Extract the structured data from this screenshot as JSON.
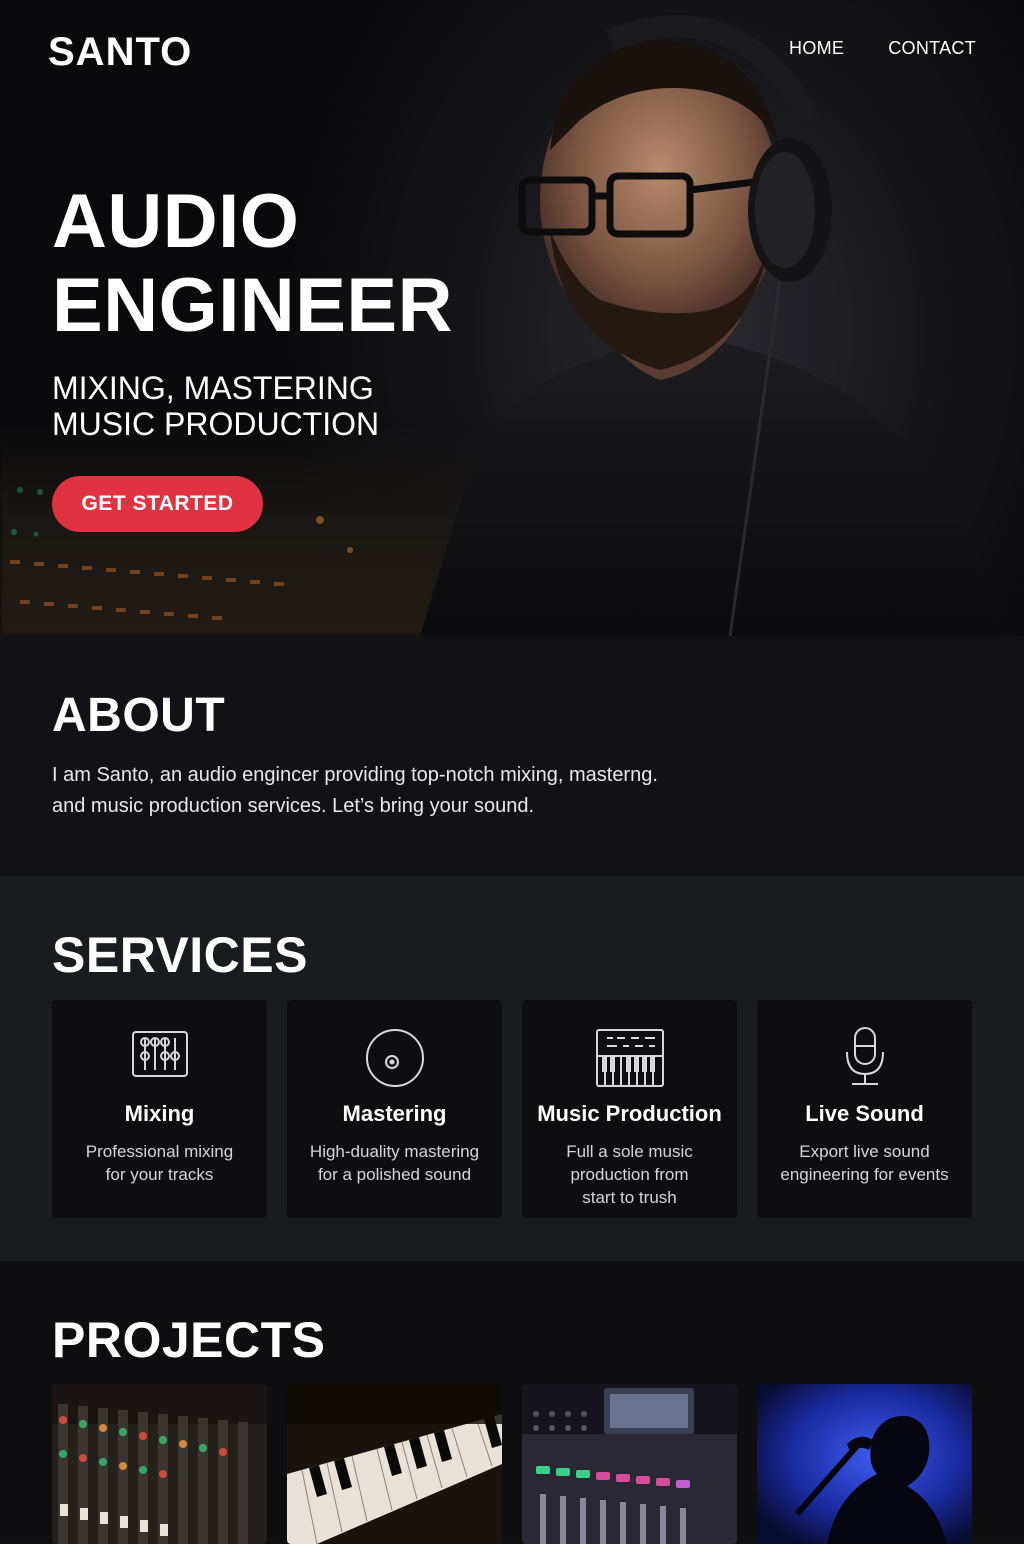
{
  "header": {
    "brand": "SANTO",
    "nav": [
      "HOME",
      "CONTACT"
    ]
  },
  "hero": {
    "title_line1": "AUDIO",
    "title_line2": "ENGINEER",
    "subtitle_line1": "MIXING, MASTERING",
    "subtitle_line2": "MUSIC PRODUCTION",
    "cta_label": "GET STARTED"
  },
  "about": {
    "heading": "ABOUT",
    "text_line1": "I am Santo, an audio engincer providing top-notch mixing, masterng.",
    "text_line2": "and music production services. Let’s bring your sound."
  },
  "services": {
    "heading": "SERVICES",
    "items": [
      {
        "title": "Mixing",
        "desc_lines": [
          "Professional mixing",
          "for your tracks"
        ],
        "icon": "mixer-faders-icon"
      },
      {
        "title": "Mastering",
        "desc_lines": [
          "High-duality mastering",
          "for a polished sound"
        ],
        "icon": "vinyl-disc-icon"
      },
      {
        "title": "Music Production",
        "desc_lines": [
          "Full a sole music",
          "production from",
          "start to trush"
        ],
        "icon": "keyboard-synth-icon"
      },
      {
        "title": "Live Sound",
        "desc_lines": [
          "Export live sound",
          "engineering for events"
        ],
        "icon": "microphone-icon"
      }
    ]
  },
  "projects": {
    "heading": "PROJECTS",
    "items": [
      "mixing-console-photo",
      "piano-keys-photo",
      "digital-mixer-photo",
      "singer-silhouette-photo"
    ]
  },
  "colors": {
    "accent": "#e03240",
    "background": "#0f0f12",
    "card": "#0e0e11"
  }
}
